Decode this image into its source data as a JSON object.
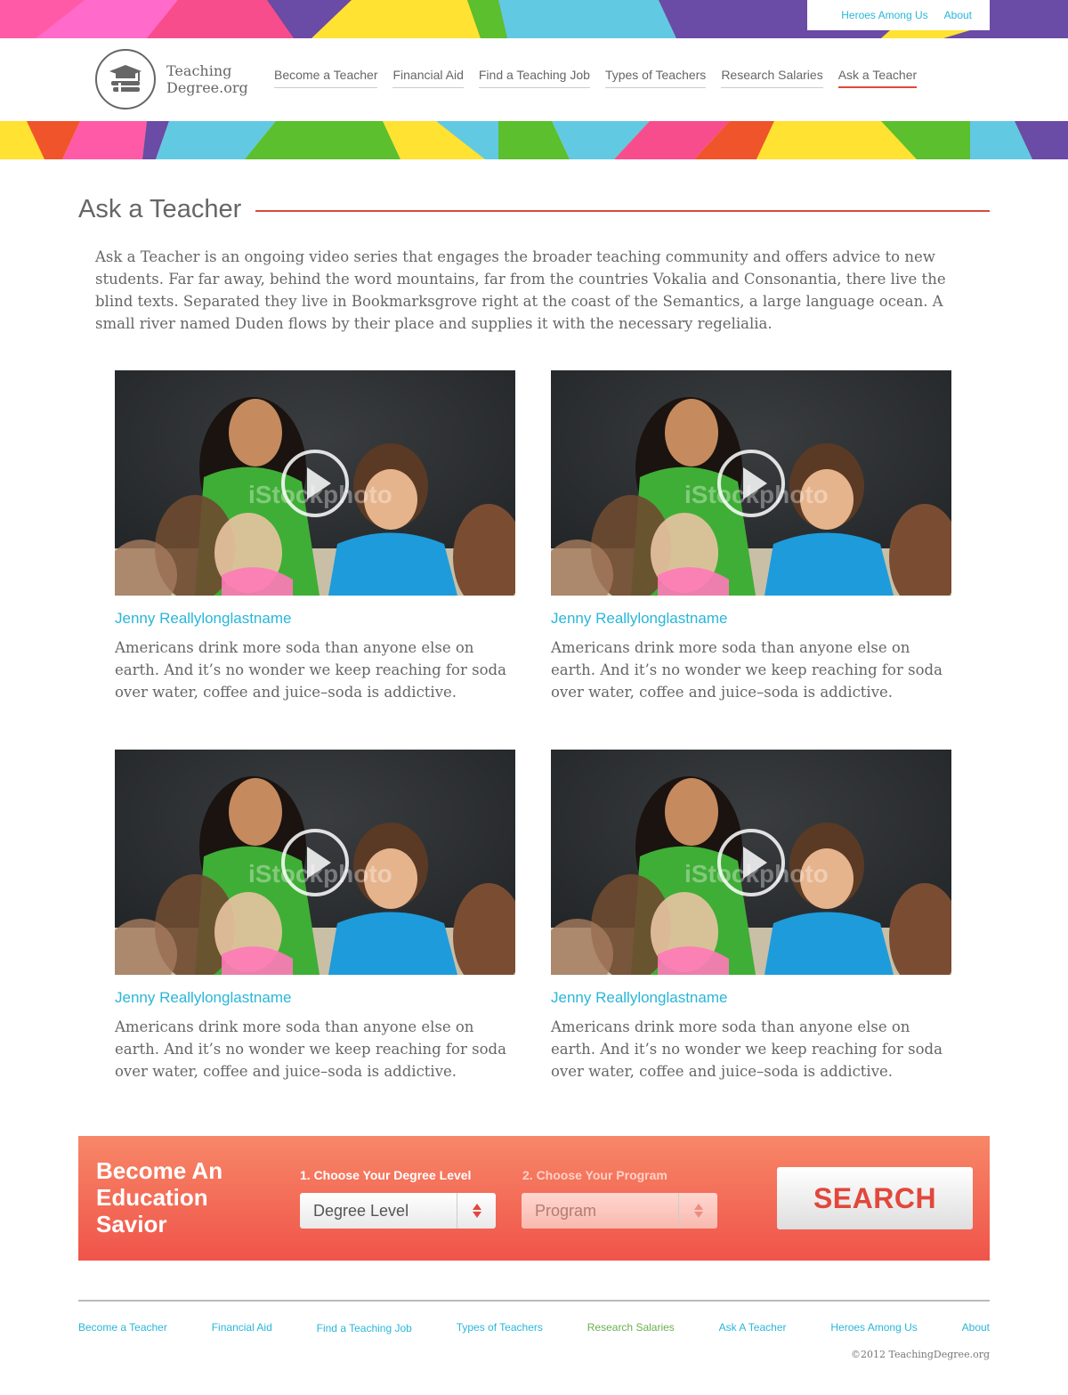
{
  "top_links": [
    "Heroes Among Us",
    "About"
  ],
  "logo": {
    "line1": "Teaching",
    "line2": "Degree.org"
  },
  "nav": [
    {
      "label": "Become a Teacher",
      "active": false
    },
    {
      "label": "Financial Aid",
      "active": false
    },
    {
      "label": "Find a Teaching Job",
      "active": false
    },
    {
      "label": "Types of Teachers",
      "active": false
    },
    {
      "label": "Research Salaries",
      "active": false
    },
    {
      "label": "Ask a Teacher",
      "active": true
    }
  ],
  "page": {
    "title": "Ask a Teacher",
    "intro": "Ask a Teacher is an ongoing video series that engages the broader teaching community and offers advice to new students. Far far away, behind the word mountains, far from the countries Vokalia and Consonantia, there live the blind texts. Separated they live in Bookmarksgrove right at the coast of the Semantics, a large language ocean. A small river named Duden flows by their place and supplies it with the necessary regelialia."
  },
  "videos": [
    {
      "name": "Jenny Reallylonglastname",
      "desc": "Americans drink more soda than anyone else on earth. And it’s no wonder we keep reaching for soda over water, coffee and juice–soda is addictive.",
      "watermark": "iStockphoto"
    },
    {
      "name": "Jenny Reallylonglastname",
      "desc": "Americans drink more soda than anyone else on earth. And it’s no wonder we keep reaching for soda over water, coffee and juice–soda is addictive.",
      "watermark": "iStockphoto"
    },
    {
      "name": "Jenny Reallylonglastname",
      "desc": "Americans drink more soda than anyone else on earth. And it’s no wonder we keep reaching for soda over water, coffee and juice–soda is addictive.",
      "watermark": "iStockphoto"
    },
    {
      "name": "Jenny Reallylonglastname",
      "desc": "Americans drink more soda than anyone else on earth. And it’s no wonder we keep reaching for soda over water, coffee and juice–soda is addictive.",
      "watermark": "iStockphoto"
    }
  ],
  "cta": {
    "title": "Become An Education Savior",
    "step1": "1. Choose Your Degree Level",
    "step2": "2. Choose Your Program",
    "select1": "Degree Level",
    "select2": "Program",
    "search": "SEARCH"
  },
  "footer": {
    "links": [
      {
        "label": "Become a Teacher",
        "style": "blue"
      },
      {
        "label": "Financial Aid",
        "style": "blue"
      },
      {
        "label": "Find a Teaching Job",
        "style": "blue"
      },
      {
        "label": "Types of Teachers",
        "style": "blue"
      },
      {
        "label": "Research Salaries",
        "style": "green"
      },
      {
        "label": "Ask A Teacher",
        "style": "blue"
      },
      {
        "label": "Heroes Among Us",
        "style": "blue"
      },
      {
        "label": "About",
        "style": "blue"
      }
    ],
    "copyright": "©2012 TeachingDegree.org"
  },
  "colors": {
    "accent_red": "#e2473b",
    "link_blue": "#29b6d8",
    "link_green": "#6ab04c"
  }
}
